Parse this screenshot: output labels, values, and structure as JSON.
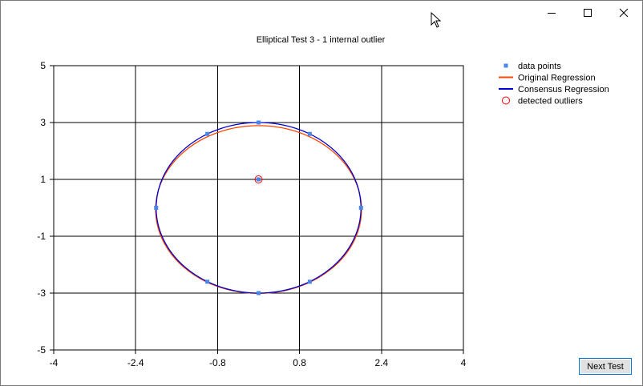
{
  "window": {
    "minimize_icon": "minimize-icon",
    "maximize_icon": "maximize-icon",
    "close_icon": "close-icon"
  },
  "next_button_label": "Next Test",
  "cursor_icon": "mouse-cursor-icon",
  "chart_data": {
    "type": "scatter",
    "title": "Elliptical Test 3 - 1 internal outlier",
    "xlabel": "",
    "ylabel": "",
    "xlim": [
      -4,
      4
    ],
    "ylim": [
      -5,
      5
    ],
    "x_ticks": [
      "-4",
      "-2.4",
      "-0.8",
      "0.8",
      "2.4",
      "4"
    ],
    "y_ticks": [
      "5",
      "3",
      "1",
      "-1",
      "-3",
      "-5"
    ],
    "grid": true,
    "legend_position": "top-right",
    "series": [
      {
        "name": "data points",
        "kind": "points",
        "color": "#4a86e8",
        "x": [
          0,
          1,
          2,
          1,
          0,
          -1,
          -2,
          -1,
          0
        ],
        "y": [
          3,
          2.6,
          0,
          -2.6,
          -3,
          -2.6,
          0,
          2.6,
          1
        ]
      },
      {
        "name": "Original Regression",
        "kind": "ellipse",
        "color": "#ff4500",
        "center": [
          0,
          -0.06
        ],
        "radii": [
          2.01,
          2.95
        ]
      },
      {
        "name": "Consensus Regression",
        "kind": "ellipse",
        "color": "#0000cd",
        "center": [
          0,
          0
        ],
        "radii": [
          2.0,
          3.0
        ]
      },
      {
        "name": "detected outliers",
        "kind": "outliers",
        "color": "#ff0000",
        "x": [
          0
        ],
        "y": [
          1
        ]
      }
    ]
  }
}
